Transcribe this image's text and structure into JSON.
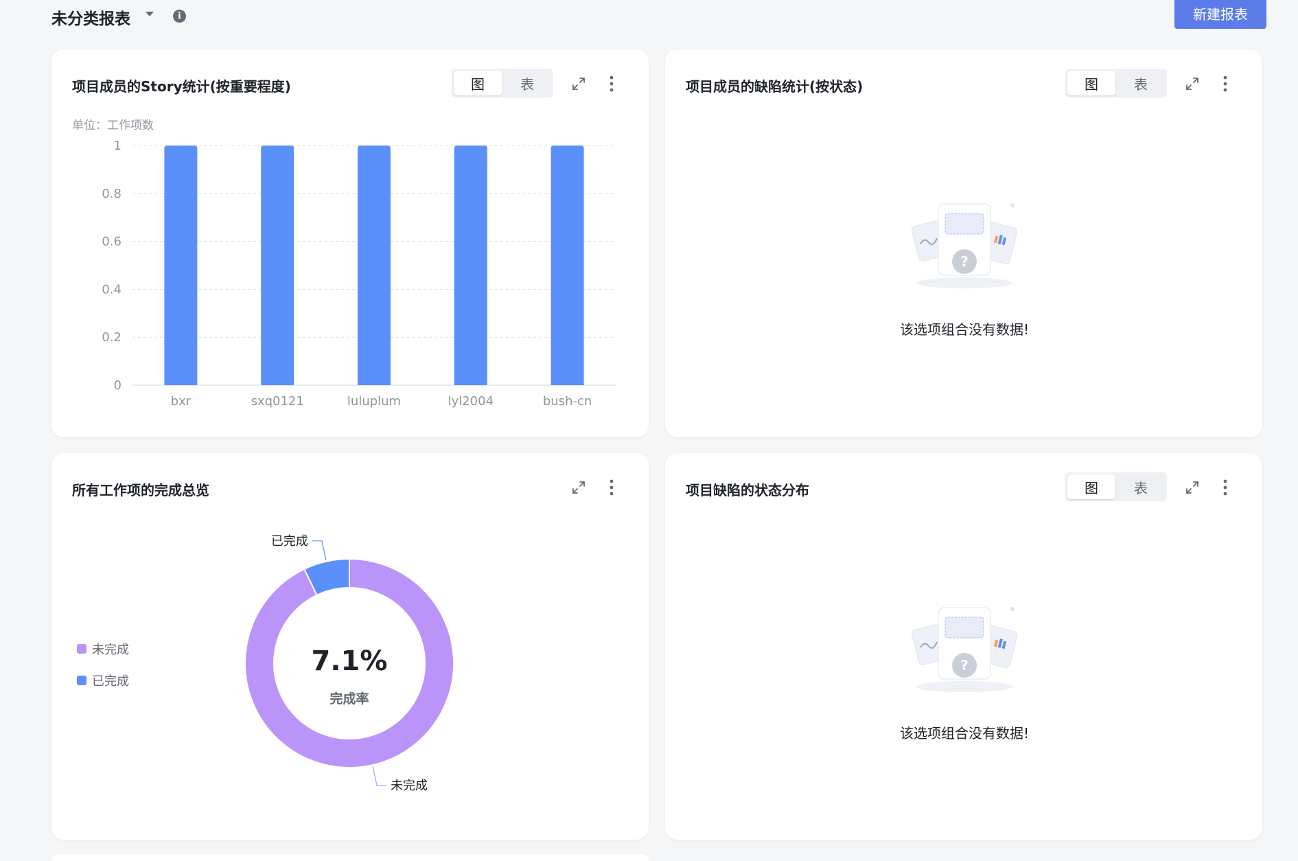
{
  "header": {
    "title": "未分类报表",
    "new_report_label": "新建报表",
    "accent": "#5b7be8"
  },
  "cards": {
    "story_stats": {
      "title": "项目成员的Story统计(按重要程度)",
      "seg_chart": "图",
      "seg_table": "表",
      "unit": "单位：工作项数"
    },
    "defect_stats": {
      "title": "项目成员的缺陷统计(按状态)",
      "seg_chart": "图",
      "seg_table": "表",
      "empty_text": "该选项组合没有数据!"
    },
    "completion": {
      "title": "所有工作项的完成总览",
      "center_value": "7.1%",
      "center_label": "完成率",
      "legend": [
        "未完成",
        "已完成"
      ],
      "label_done": "已完成",
      "label_undone": "未完成"
    },
    "defect_status": {
      "title": "项目缺陷的状态分布",
      "seg_chart": "图",
      "seg_table": "表",
      "empty_text": "该选项组合没有数据!"
    }
  },
  "icons": {
    "dropdown": "chevron-down-icon",
    "info": "info-icon",
    "expand": "expand-icon",
    "more": "more-vertical-icon",
    "empty": "empty-data-illustration"
  },
  "chart_data": [
    {
      "type": "bar",
      "title": "项目成员的Story统计(按重要程度)",
      "ylabel": "单位：工作项数",
      "categories": [
        "bxr",
        "sxq0121",
        "luluplum",
        "lyl2004",
        "bush-cn"
      ],
      "values": [
        1,
        1,
        1,
        1,
        1
      ],
      "ylim": [
        0,
        1
      ],
      "yticks": [
        "0",
        "0.2",
        "0.4",
        "0.6",
        "0.8",
        "1"
      ],
      "grid": true,
      "color": "#5b8ff9"
    },
    {
      "type": "pie",
      "title": "所有工作项的完成总览",
      "slices": [
        {
          "name": "未完成",
          "value": 92.9,
          "color": "#bb94f9"
        },
        {
          "name": "已完成",
          "value": 7.1,
          "color": "#5b8ff9"
        }
      ],
      "legend": "left"
    }
  ]
}
